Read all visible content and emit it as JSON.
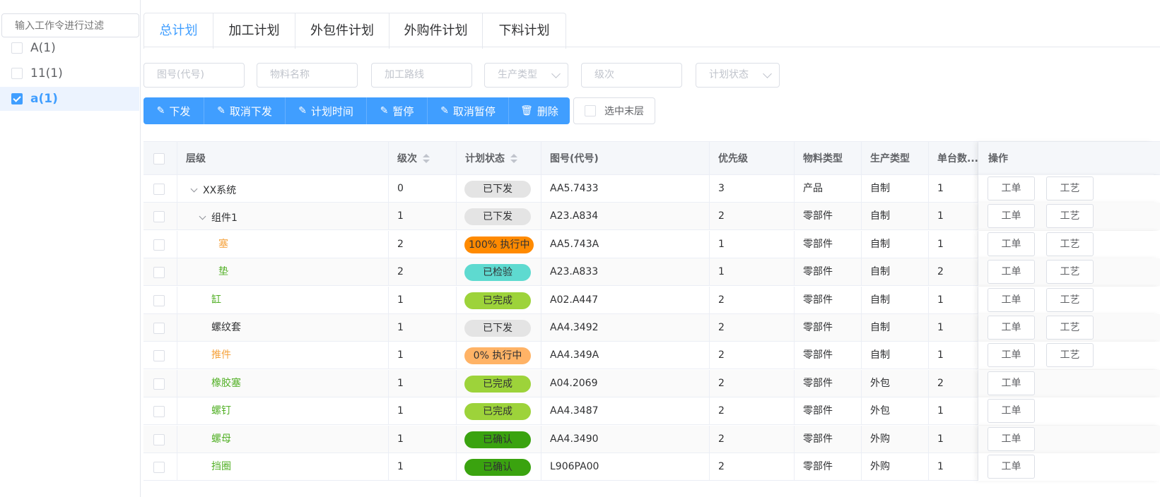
{
  "sidebar": {
    "filter_placeholder": "输入工作令进行过滤",
    "items": [
      {
        "label": "A(1)",
        "checked": false
      },
      {
        "label": "11(1)",
        "checked": false
      },
      {
        "label": "a(1)",
        "checked": true
      }
    ]
  },
  "tabs": [
    {
      "label": "总计划",
      "active": true
    },
    {
      "label": "加工计划",
      "active": false
    },
    {
      "label": "外包件计划",
      "active": false
    },
    {
      "label": "外购件计划",
      "active": false
    },
    {
      "label": "下料计划",
      "active": false
    }
  ],
  "filters": {
    "drawing_no": "图号(代号)",
    "material_name": "物料名称",
    "route": "加工路线",
    "production_type": "生产类型",
    "level": "级次",
    "plan_status": "计划状态"
  },
  "toolbar": {
    "issue": "下发",
    "cancel_issue": "取消下发",
    "plan_time": "计划时间",
    "pause": "暂停",
    "cancel_pause": "取消暂停",
    "delete": "删除",
    "select_leaf": "选中末层"
  },
  "table": {
    "headers": {
      "hierarchy": "层级",
      "level": "级次",
      "plan_status": "计划状态",
      "drawing_no": "图号(代号)",
      "priority": "优先级",
      "material_type": "物料类型",
      "production_type": "生产类型",
      "unit_qty": "单台数...",
      "operation": "操作"
    },
    "op_labels": {
      "work_order": "工单",
      "process": "工艺"
    },
    "rows": [
      {
        "name": "XX系统",
        "name_color": "#303133",
        "level": "0",
        "status": "已下发",
        "status_color": "#e4e4e4",
        "drawing": "AA5.7433",
        "priority": "3",
        "material_type": "产品",
        "production_type": "自制",
        "unit_qty": "1",
        "has_process": true
      },
      {
        "name": "组件1",
        "name_color": "#303133",
        "level": "1",
        "status": "已下发",
        "status_color": "#e4e4e4",
        "drawing": "A23.A834",
        "priority": "2",
        "material_type": "零部件",
        "production_type": "自制",
        "unit_qty": "1",
        "has_process": true
      },
      {
        "name": "塞",
        "name_color": "#f5a23c",
        "level": "2",
        "status": "100% 执行中",
        "status_color": "#ff8a00",
        "drawing": "AA5.743A",
        "priority": "1",
        "material_type": "零部件",
        "production_type": "自制",
        "unit_qty": "1",
        "has_process": true
      },
      {
        "name": "垫",
        "name_color": "#52b026",
        "level": "2",
        "status": "已检验",
        "status_color": "#5edad0",
        "drawing": "A23.A833",
        "priority": "1",
        "material_type": "零部件",
        "production_type": "自制",
        "unit_qty": "2",
        "has_process": true
      },
      {
        "name": "缸",
        "name_color": "#52b026",
        "level": "1",
        "status": "已完成",
        "status_color": "#9dd33a",
        "drawing": "A02.A447",
        "priority": "2",
        "material_type": "零部件",
        "production_type": "自制",
        "unit_qty": "1",
        "has_process": true
      },
      {
        "name": "螺纹套",
        "name_color": "#303133",
        "level": "1",
        "status": "已下发",
        "status_color": "#e4e4e4",
        "drawing": "AA4.3492",
        "priority": "2",
        "material_type": "零部件",
        "production_type": "自制",
        "unit_qty": "1",
        "has_process": true
      },
      {
        "name": "推件",
        "name_color": "#f5a23c",
        "level": "1",
        "status": "0% 执行中",
        "status_color": "#ffb366",
        "drawing": "AA4.349A",
        "priority": "2",
        "material_type": "零部件",
        "production_type": "自制",
        "unit_qty": "1",
        "has_process": true
      },
      {
        "name": "橡胶塞",
        "name_color": "#52b026",
        "level": "1",
        "status": "已完成",
        "status_color": "#9dd33a",
        "drawing": "A04.2069",
        "priority": "2",
        "material_type": "零部件",
        "production_type": "外包",
        "unit_qty": "2",
        "has_process": false
      },
      {
        "name": "螺钉",
        "name_color": "#52b026",
        "level": "1",
        "status": "已完成",
        "status_color": "#9dd33a",
        "drawing": "AA4.3487",
        "priority": "2",
        "material_type": "零部件",
        "production_type": "外包",
        "unit_qty": "1",
        "has_process": false
      },
      {
        "name": "螺母",
        "name_color": "#52b026",
        "level": "1",
        "status": "已确认",
        "status_color": "#3aa30f",
        "drawing": "AA4.3490",
        "priority": "2",
        "material_type": "零部件",
        "production_type": "外购",
        "unit_qty": "1",
        "has_process": false
      },
      {
        "name": "挡圈",
        "name_color": "#52b026",
        "level": "1",
        "status": "已确认",
        "status_color": "#3aa30f",
        "drawing": "L906PA00",
        "priority": "2",
        "material_type": "零部件",
        "production_type": "外购",
        "unit_qty": "1",
        "has_process": false
      }
    ]
  }
}
